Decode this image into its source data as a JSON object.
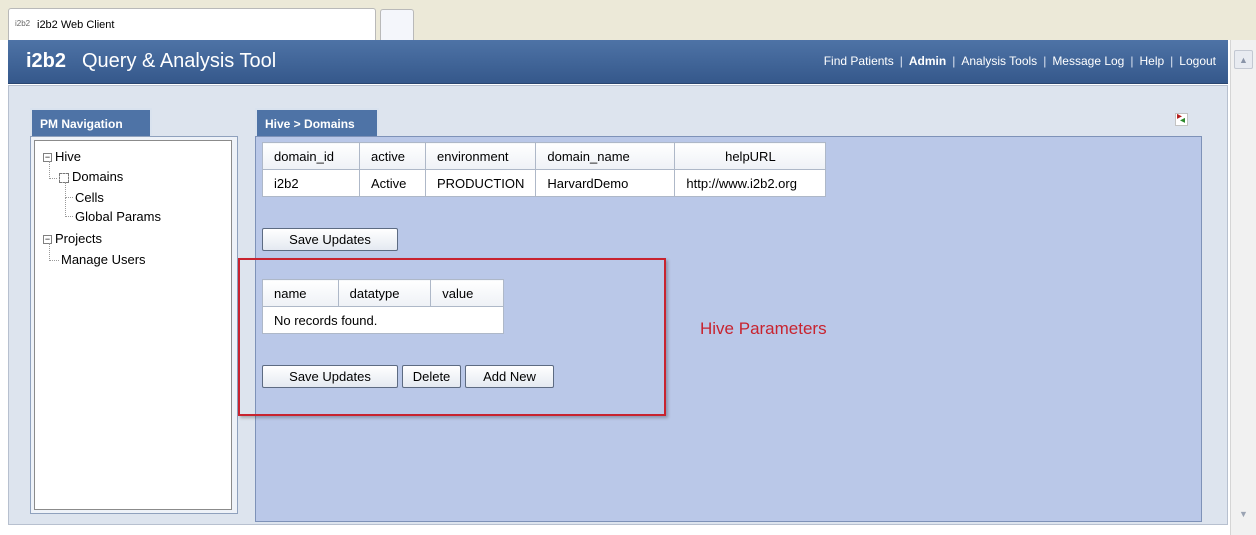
{
  "browser": {
    "tab_favicon_text": "i2b2",
    "tab_title": "i2b2 Web Client"
  },
  "app": {
    "logo": "i2b2",
    "title": "Query & Analysis Tool"
  },
  "topnav": [
    {
      "label": "Find Patients",
      "active": false
    },
    {
      "label": "Admin",
      "active": true
    },
    {
      "label": "Analysis Tools",
      "active": false
    },
    {
      "label": "Message Log",
      "active": false
    },
    {
      "label": "Help",
      "active": false
    },
    {
      "label": "Logout",
      "active": false
    }
  ],
  "pm_navigation": {
    "title": "PM Navigation",
    "tree": {
      "hive_label": "Hive",
      "domains_label": "Domains",
      "cells_label": "Cells",
      "global_params_label": "Global Params",
      "projects_label": "Projects",
      "manage_users_label": "Manage Users"
    }
  },
  "main": {
    "tab_title": "Hive > Domains",
    "domains_table": {
      "headers": [
        "domain_id",
        "active",
        "environment",
        "domain_name",
        "helpURL"
      ],
      "rows": [
        [
          "i2b2",
          "Active",
          "PRODUCTION",
          "HarvardDemo",
          "http://www.i2b2.org"
        ]
      ]
    },
    "save_updates_label": "Save Updates",
    "params_table": {
      "headers": [
        "name",
        "datatype",
        "value"
      ],
      "empty_message": "No records found."
    },
    "params_buttons": {
      "save_updates": "Save Updates",
      "delete": "Delete",
      "add_new": "Add New"
    },
    "annotation": "Hive Parameters"
  },
  "colors": {
    "header_blue": "#4e73a6",
    "panel_background": "#bac8e8",
    "annotation_red": "#c8232f"
  }
}
